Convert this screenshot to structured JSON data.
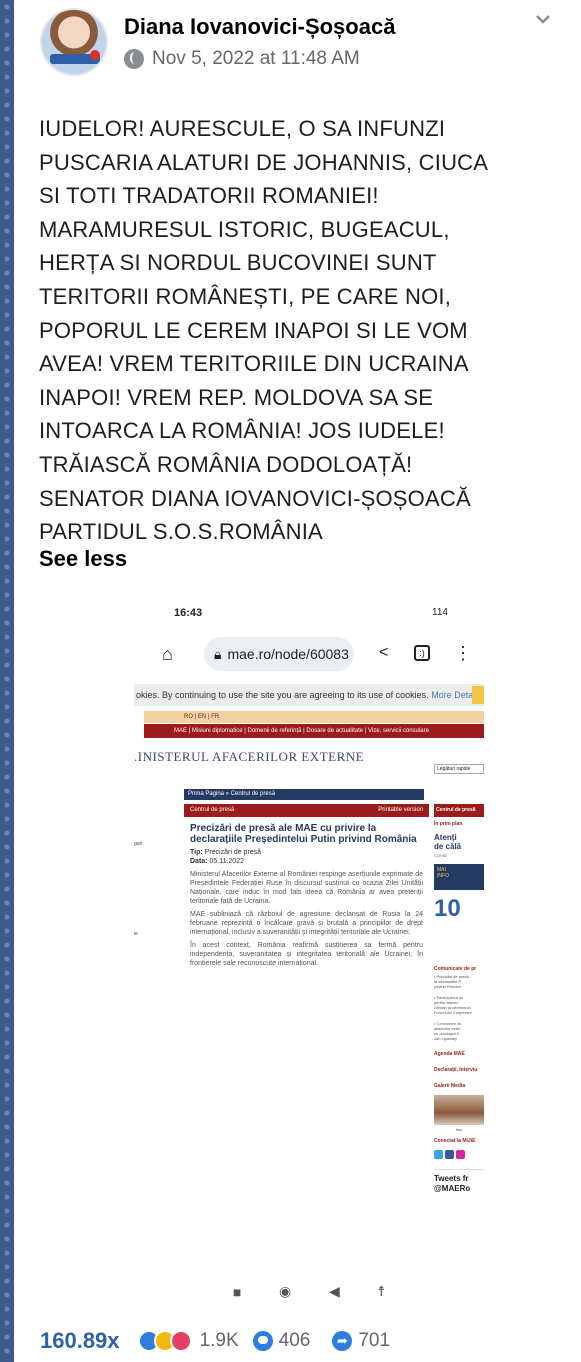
{
  "post": {
    "author": "Diana Iovanovici-Șoșoacă",
    "timestamp": "Nov 5, 2022 at 11:48 AM",
    "body_lines": [
      "IUDELOR! AURESCULE, O SA INFUNZI",
      "PUSCARIA ALATURI DE JOHANNIS, CIUCA",
      "SI TOTI TRADATORII ROMANIEI!",
      "MARAMURESUL ISTORIC, BUGEACUL,",
      "HERȚA SI NORDUL BUCOVINEI SUNT",
      "TERITORII ROMÂNEȘTI, PE CARE NOI,",
      "POPORUL LE CEREM INAPOI SI LE VOM",
      "AVEA! VREM TERITORIILE DIN UCRAINA",
      "INAPOI! VREM REP. MOLDOVA SA SE",
      "INTOARCA LA ROMÂNIA! JOS IUDELE!",
      "TRĂIASCĂ ROMÂNIA DODOLOAȚĂ!",
      "SENATOR DIANA IOVANOVICI-ȘOȘOACĂ",
      "PARTIDUL S.O.S.ROMÂNIA"
    ],
    "see_less": "See less"
  },
  "screenshot": {
    "status_time": "16:43",
    "status_right": "114",
    "url": "mae.ro/node/60083",
    "cookie_text": "okies. By continuing to use the site you are agreeing to its use of cookies.",
    "cookie_more": "More Details",
    "ministry": ".INISTERUL AFACERILOR EXTERNE",
    "legis": "Legături rapide",
    "breadcrumb": "Prima Pagina  »  Centrul de presă",
    "section": "Centrul de presă",
    "printable": "Printable version",
    "title": "Precizări de presă ale MAE cu privire la declarațiile Președintelui Putin privind România",
    "tip_label": "Tip:",
    "tip_value": "Precizări de presă",
    "date_label": "Data:",
    "date_value": "05.11.2022",
    "para1": "Ministerul Afacerilor Externe al României respinge aserțiunile exprimate de Președintele Federației Ruse în discursul susținut cu ocazia Zilei Unității Naționale, care induc în mod fals ideea că România ar avea pretenții teritoriale față de Ucraina.",
    "para2": "MAE subliniază că războiul de agresiune declanșat de Rusia la 24 februarie reprezintă o încălcare gravă și brutală a principiilor de drept internațional, inclusiv a suveranității și integrității teritoriale ale Ucrainei.",
    "para3": "În acest context, România reafirmă susținerea sa fermă pentru independența, suveranitatea și integritatea teritorială ale Ucrainei, în frontierele sale recunoscute internațional.",
    "side_head": "Centrul de presă",
    "side_prim": "În prim plan",
    "side_att1": "Atenți",
    "side_att2": "de călă",
    "side_covid": "COVID",
    "side_big": "10",
    "side_comm": "Comunicate de pr",
    "side_agenda": "Agenda MAE",
    "side_decl": "Declarații, Interviu",
    "side_galerie": "Galerii Media",
    "side_foto": "foto",
    "side_conect": "Conectat la MiJiE",
    "side_tweets1": "Tweets fr",
    "side_tweets2": "@MAERo"
  },
  "footer": {
    "views": "160.89x",
    "reactions": "1.9K",
    "comments": "406",
    "shares": "701"
  }
}
